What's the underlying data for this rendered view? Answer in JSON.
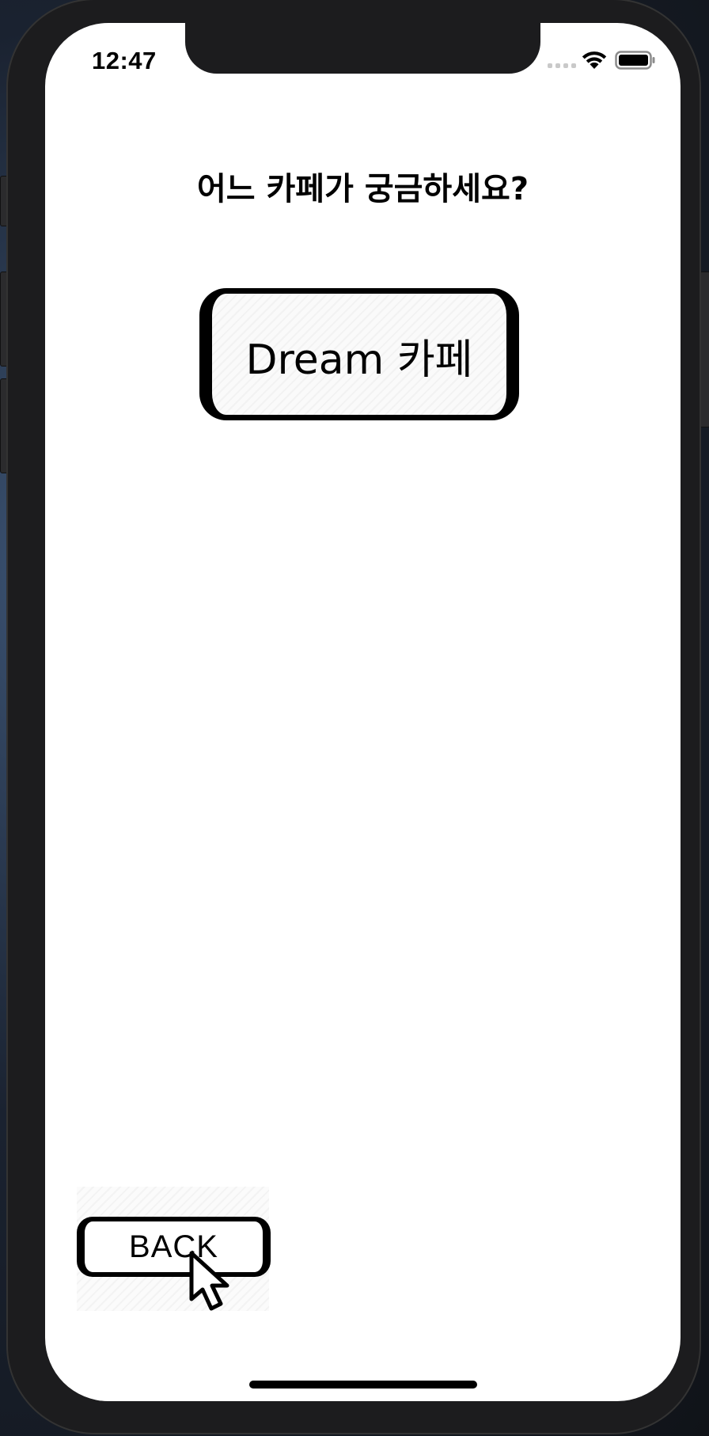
{
  "status_bar": {
    "time": "12:47",
    "icons": [
      "cellular-signal-icon",
      "wifi-icon",
      "battery-icon"
    ]
  },
  "screen": {
    "title": "어느 카페가 궁금하세요?",
    "cafe_button_label": "Dream 카페",
    "back_button_label": "BACK"
  },
  "colors": {
    "background": "#ffffff",
    "text": "#000000",
    "button_border": "#000000",
    "device_frame": "#1c1c1e"
  }
}
